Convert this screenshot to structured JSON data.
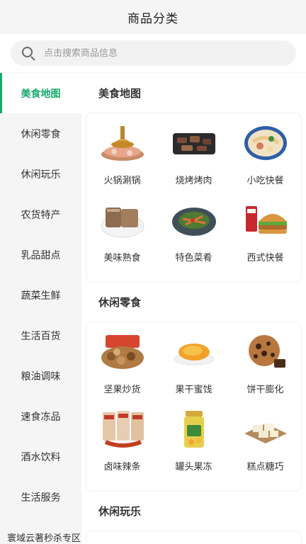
{
  "header": {
    "title": "商品分类"
  },
  "search": {
    "placeholder": "点击搜索商品信息"
  },
  "sidebar": {
    "items": [
      {
        "label": "美食地图",
        "active": true
      },
      {
        "label": "休闲零食"
      },
      {
        "label": "休闲玩乐"
      },
      {
        "label": "农货特产"
      },
      {
        "label": "乳品甜点"
      },
      {
        "label": "蔬菜生鲜"
      },
      {
        "label": "生活百货"
      },
      {
        "label": "粮油调味"
      },
      {
        "label": "速食冻品"
      },
      {
        "label": "酒水饮料"
      },
      {
        "label": "生活服务"
      },
      {
        "label": "寰域云著秒杀专区"
      }
    ]
  },
  "sections": [
    {
      "title": "美食地图",
      "items": [
        {
          "label": "火锅涮锅",
          "icon": "hotpot-icon"
        },
        {
          "label": "烧烤烤肉",
          "icon": "bbq-icon"
        },
        {
          "label": "小吃快餐",
          "icon": "noodle-bowl-icon"
        },
        {
          "label": "美味熟食",
          "icon": "cooked-meat-icon"
        },
        {
          "label": "特色菜肴",
          "icon": "dish-icon"
        },
        {
          "label": "西式快餐",
          "icon": "burger-icon"
        }
      ]
    },
    {
      "title": "休闲零食",
      "items": [
        {
          "label": "坚果炒货",
          "icon": "nuts-icon"
        },
        {
          "label": "果干蜜饯",
          "icon": "dried-fruit-icon"
        },
        {
          "label": "饼干膨化",
          "icon": "cookie-icon"
        },
        {
          "label": "卤味辣条",
          "icon": "spicy-strip-icon"
        },
        {
          "label": "罐头果冻",
          "icon": "jar-icon"
        },
        {
          "label": "糕点糖巧",
          "icon": "pastry-icon"
        }
      ]
    },
    {
      "title": "休闲玩乐",
      "items": []
    }
  ]
}
